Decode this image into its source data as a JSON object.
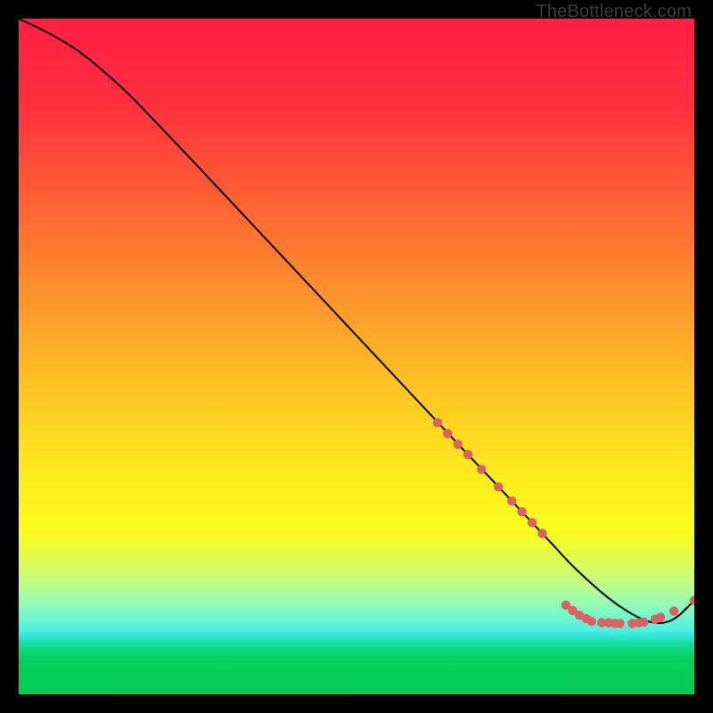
{
  "watermark": "TheBottleneck.com",
  "gradient_stops": [
    {
      "pct": 0.0,
      "color": "#ff1f44"
    },
    {
      "pct": 0.12,
      "color": "#ff2e3f"
    },
    {
      "pct": 0.25,
      "color": "#fe5a36"
    },
    {
      "pct": 0.4,
      "color": "#fd8f2d"
    },
    {
      "pct": 0.55,
      "color": "#fdc524"
    },
    {
      "pct": 0.68,
      "color": "#fcec1e"
    },
    {
      "pct": 0.755,
      "color": "#fbfb1d"
    },
    {
      "pct": 0.772,
      "color": "#f3fb2b"
    },
    {
      "pct": 0.79,
      "color": "#e7fb45"
    },
    {
      "pct": 0.81,
      "color": "#d8fb60"
    },
    {
      "pct": 0.828,
      "color": "#c7fb7b"
    },
    {
      "pct": 0.845,
      "color": "#b4fb95"
    },
    {
      "pct": 0.86,
      "color": "#9efaad"
    },
    {
      "pct": 0.875,
      "color": "#85f8c2"
    },
    {
      "pct": 0.89,
      "color": "#6af4d4"
    },
    {
      "pct": 0.905,
      "color": "#4feee1"
    },
    {
      "pct": 0.915,
      "color": "#2fe6d0"
    },
    {
      "pct": 0.925,
      "color": "#17dd9f"
    },
    {
      "pct": 0.935,
      "color": "#0cd579"
    },
    {
      "pct": 0.95,
      "color": "#07ce5d"
    },
    {
      "pct": 1.0,
      "color": "#06cb56"
    }
  ],
  "chart_data": {
    "type": "line",
    "title": "",
    "xlabel": "",
    "ylabel": "",
    "xlim": [
      0,
      100
    ],
    "ylim": [
      0,
      100
    ],
    "series": [
      {
        "name": "curve",
        "x": [
          0,
          3,
          6,
          9,
          12,
          16,
          20,
          26,
          32,
          38,
          44,
          50,
          56,
          62,
          66,
          70,
          73,
          76,
          79,
          81.5,
          84,
          86.5,
          89,
          91.5,
          93.5,
          95.5,
          97.5,
          100
        ],
        "values": [
          100,
          98.6,
          97.0,
          95.1,
          92.7,
          89.1,
          85.0,
          78.7,
          72.3,
          65.9,
          59.5,
          53.1,
          46.7,
          40.3,
          36.0,
          31.8,
          28.6,
          25.4,
          22.2,
          19.5,
          17.1,
          14.9,
          13.0,
          11.5,
          10.7,
          10.6,
          11.5,
          13.9
        ]
      }
    ],
    "markers": [
      {
        "x": 62.0,
        "y": 40.2
      },
      {
        "x": 63.5,
        "y": 38.6
      },
      {
        "x": 65.0,
        "y": 37.0
      },
      {
        "x": 66.5,
        "y": 35.5
      },
      {
        "x": 68.5,
        "y": 33.3
      },
      {
        "x": 71.0,
        "y": 30.7
      },
      {
        "x": 73.0,
        "y": 28.6
      },
      {
        "x": 74.5,
        "y": 27.0
      },
      {
        "x": 76.0,
        "y": 25.4
      },
      {
        "x": 77.5,
        "y": 23.8
      },
      {
        "x": 81.0,
        "y": 13.2
      },
      {
        "x": 82.0,
        "y": 12.4
      },
      {
        "x": 83.0,
        "y": 11.7
      },
      {
        "x": 84.0,
        "y": 11.2
      },
      {
        "x": 84.8,
        "y": 10.8
      },
      {
        "x": 86.3,
        "y": 10.6
      },
      {
        "x": 87.3,
        "y": 10.6
      },
      {
        "x": 88.2,
        "y": 10.5
      },
      {
        "x": 89.0,
        "y": 10.5
      },
      {
        "x": 90.8,
        "y": 10.5
      },
      {
        "x": 91.8,
        "y": 10.6
      },
      {
        "x": 92.5,
        "y": 10.7
      },
      {
        "x": 94.2,
        "y": 11.1
      },
      {
        "x": 95.0,
        "y": 11.4
      },
      {
        "x": 97.0,
        "y": 12.3
      },
      {
        "x": 100.0,
        "y": 13.9
      }
    ],
    "marker_color": "#d96262",
    "line_color": "#000000"
  }
}
